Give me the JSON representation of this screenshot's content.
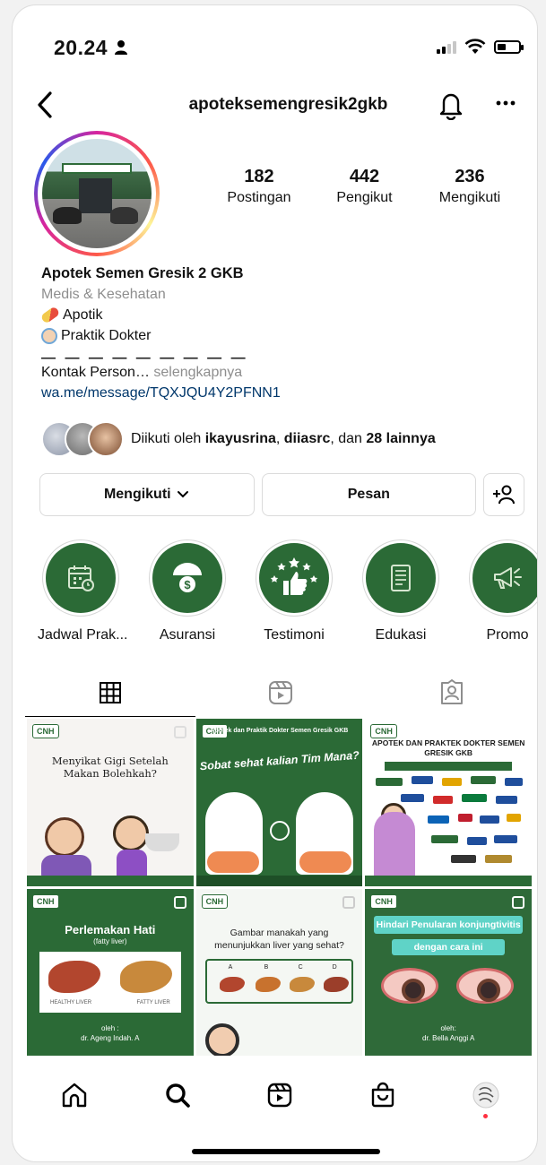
{
  "status": {
    "time": "20.24"
  },
  "header": {
    "username": "apoteksemengresik2gkb"
  },
  "stats": [
    {
      "num": "182",
      "label": "Postingan"
    },
    {
      "num": "442",
      "label": "Pengikut"
    },
    {
      "num": "236",
      "label": "Mengikuti"
    }
  ],
  "bio": {
    "name": "Apotek Semen Gresik 2 GKB",
    "category": "Medis & Kesehatan",
    "line1": "Apotik",
    "line2": "Praktik Dokter",
    "dashes": "— — — — — — — — —",
    "contact": "Kontak Person…",
    "more": "selengkapnya",
    "link": "wa.me/message/TQXJQU4Y2PFNN1"
  },
  "followed_by": {
    "prefix": "Diikuti oleh ",
    "user1": "ikayusrina",
    "sep": ", ",
    "user2": "diiasrc",
    "mid": ", dan ",
    "count": "28 lainnya"
  },
  "actions": {
    "follow": "Mengikuti",
    "message": "Pesan"
  },
  "highlights": [
    {
      "label": "Jadwal Prak...",
      "icon": "calendar-icon"
    },
    {
      "label": "Asuransi",
      "icon": "umbrella-dollar-icon"
    },
    {
      "label": "Testimoni",
      "icon": "thumbs-up-stars-icon"
    },
    {
      "label": "Edukasi",
      "icon": "document-icon"
    },
    {
      "label": "Promo",
      "icon": "megaphone-icon"
    }
  ],
  "posts": {
    "p1": {
      "brand": "CNH",
      "title": "Menyikat Gigi Setelah Makan Bolehkah?"
    },
    "p2": {
      "brand": "CNH",
      "header": "Apotek dan Praktik Dokter Semen Gresik GKB",
      "title": "Sobat sehat kalian Tim Mana?"
    },
    "p3": {
      "brand": "CNH",
      "title": "APOTEK DAN PRAKTEK DOKTER SEMEN GRESIK GKB"
    },
    "p4": {
      "brand": "CNH",
      "title": "Perlemakan Hati",
      "subtitle": "(fatty liver)",
      "label_a": "HEALTHY LIVER",
      "label_b": "FATTY LIVER",
      "byline": "oleh :",
      "author": "dr. Ageng Indah. A"
    },
    "p5": {
      "brand": "CNH",
      "title": "Gambar manakah yang menunjukkan liver yang sehat?",
      "opts": [
        "A",
        "B",
        "C",
        "D"
      ]
    },
    "p6": {
      "brand": "CNH",
      "line1": "Hindari Penularan konjungtivitis",
      "line2": "dengan cara ini",
      "byline": "oleh:",
      "author": "dr. Bella Anggi A"
    }
  },
  "colors": {
    "brand_green": "#2b6a36",
    "link": "#00376b",
    "muted": "#8e8e8e"
  }
}
